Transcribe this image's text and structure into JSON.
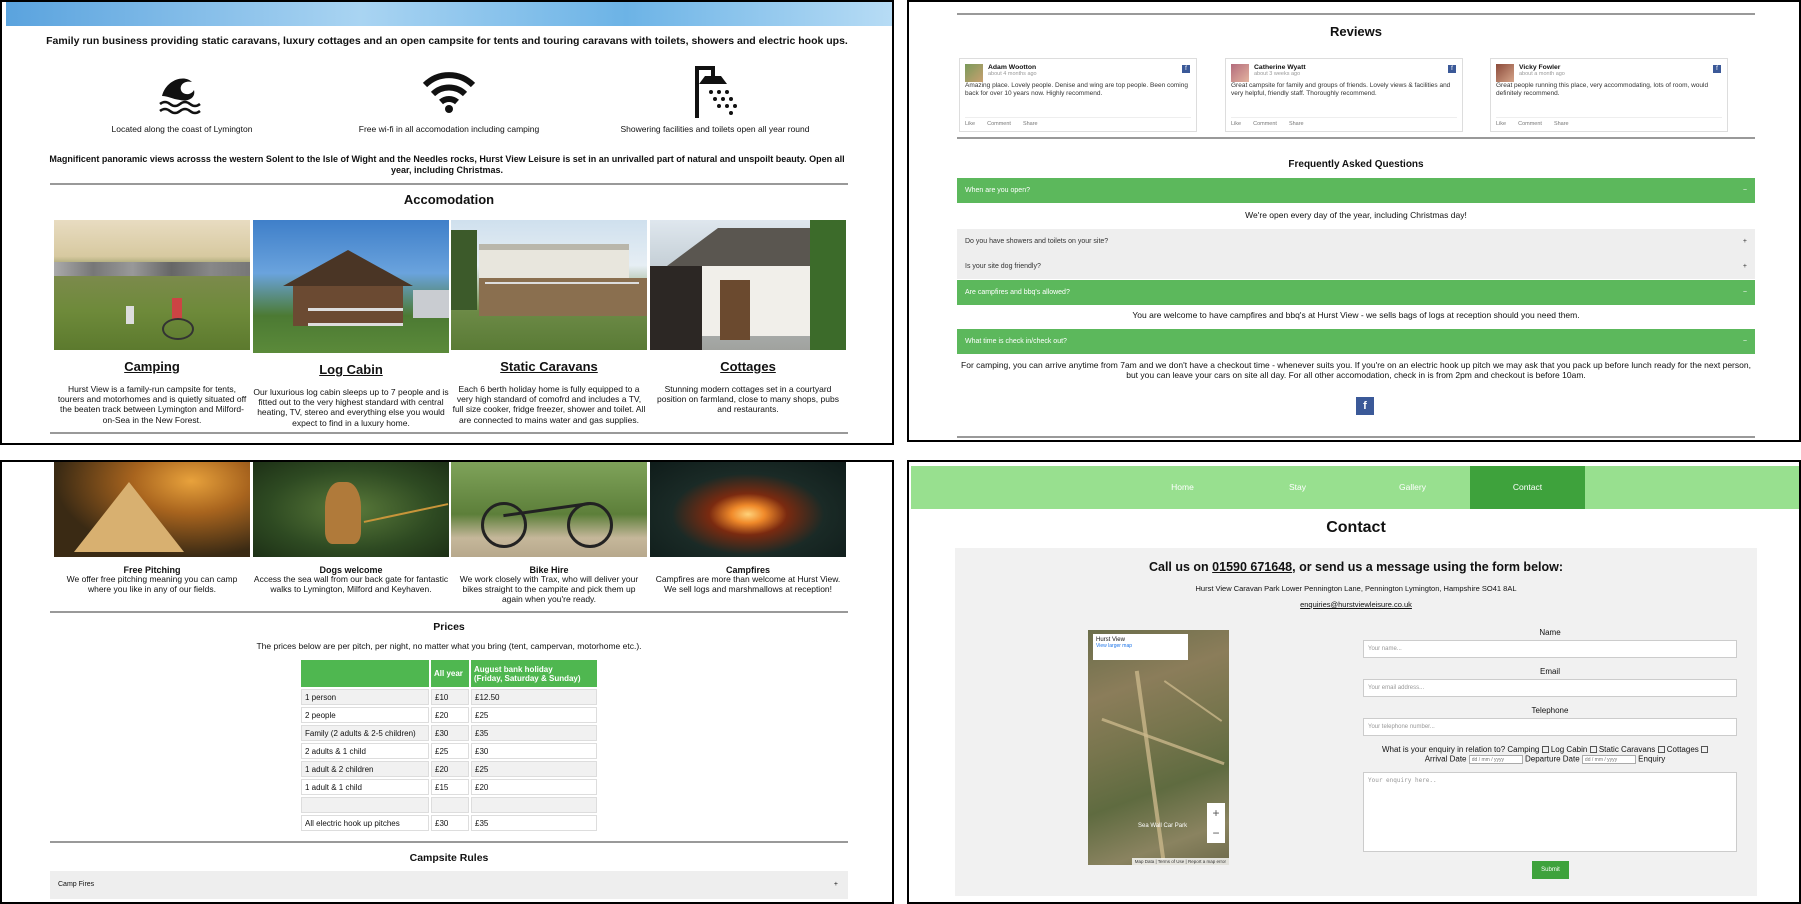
{
  "intro": {
    "tagline": "Family run business providing static caravans, luxury cottages and an open campsite for tents and touring caravans with toilets, showers and electric hook ups.",
    "features": [
      {
        "icon": "wave-icon",
        "caption": "Located along the coast of Lymington"
      },
      {
        "icon": "wifi-icon",
        "caption": "Free wi-fi in all accomodation including camping"
      },
      {
        "icon": "shower-icon",
        "caption": "Showering facilities and toilets open all year round"
      }
    ],
    "views": "Magnificent panoramic views acrosss the western Solent to the Isle of Wight and the Needles rocks, Hurst View Leisure is set in an unrivalled part of natural and unspoilt beauty. Open all year, including Christmas."
  },
  "accommodation": {
    "heading": "Accomodation",
    "cards": [
      {
        "title": "Camping",
        "desc": "Hurst View is a family-run campsite for tents, tourers and motorhomes and is quietly situated off the beaten track between Lymington and Milford-on-Sea in the New Forest."
      },
      {
        "title": "Log Cabin",
        "desc": "Our luxurious log cabin sleeps up to 7 people and is fitted out to the very highest standard with central heating, TV, stereo and everything else you would expect to find in a luxury home."
      },
      {
        "title": "Static Caravans",
        "desc": "Each 6 berth holiday home is fully equipped to a very high standard of comofrd and includes a TV, full size cooker, fridge freezer, shower and toilet. All are connected to mains water and gas supplies."
      },
      {
        "title": "Cottages",
        "desc": "Stunning modern cottages set in a courtyard position on farmland, close to many shops, pubs and restaurants."
      }
    ]
  },
  "reviews": {
    "heading": "Reviews",
    "items": [
      {
        "name": "Adam Wootton",
        "time": "about 4 months ago",
        "text": "Amazing place. Lovely people. Denise and wing are top people. Been coming back for over 10 years now. Highly recommend."
      },
      {
        "name": "Catherine Wyatt",
        "time": "about 3 weeks ago",
        "text": "Great campsite for family and groups of friends. Lovely views & facilities and very helpful, friendly staff. Thoroughly recommend."
      },
      {
        "name": "Vicky Fowler",
        "time": "about a month ago",
        "text": "Great people running this place, very accommodating, lots of room, would definitely recommend."
      }
    ],
    "actions": {
      "like": "Like",
      "comment": "Comment",
      "share": "Share"
    }
  },
  "faq": {
    "heading": "Frequently Asked Questions",
    "items": [
      {
        "q": "When are you open?",
        "a": "We're open every day of the year, including Christmas day!"
      },
      {
        "q": "Do you have showers and toilets on your site?"
      },
      {
        "q": "Is your site dog friendly?"
      },
      {
        "q": "Are campfires and bbq's allowed?",
        "a": "You are welcome to have campfires and bbq's at Hurst View - we sells bags of logs at reception should you need them."
      },
      {
        "q": "What time is check in/check out?",
        "a": "For camping, you can arrive anytime from 7am and we don't have a checkout time - whenever suits you. If you're on an electric hook up pitch we may ask that you pack up before lunch ready for the next person, but you can leave your cars on site all day. For all other accomodation, check in is from 2pm and checkout is before 10am."
      }
    ],
    "fb_label": "f"
  },
  "camping": {
    "cards": [
      {
        "title": "Free Pitching",
        "desc": "We offer free pitching meaning you can camp where you like in any of our fields."
      },
      {
        "title": "Dogs welcome",
        "desc": "Access the sea wall from our back gate for fantastic walks to Lymington, Milford and Keyhaven."
      },
      {
        "title": "Bike Hire",
        "desc": "We work closely with Trax, who will deliver your bikes straight to the campite and pick them up again when you're ready."
      },
      {
        "title": "Campfires",
        "desc": "Campfires are more than welcome at Hurst View. We sell logs and marshmallows at reception!"
      }
    ]
  },
  "prices": {
    "heading": "Prices",
    "note": "The prices below are per pitch, per night, no matter what you bring (tent, campervan, motorhome etc.).",
    "col_all": "All year",
    "col_aug1": "August bank holiday",
    "col_aug2": "(Friday, Saturday & Sunday)",
    "rows": [
      [
        "1 person",
        "£10",
        "£12.50"
      ],
      [
        "2 people",
        "£20",
        "£25"
      ],
      [
        "Family (2 adults & 2-5 children)",
        "£30",
        "£35"
      ],
      [
        "2 adults & 1 child",
        "£25",
        "£30"
      ],
      [
        "1 adult & 2 children",
        "£20",
        "£25"
      ],
      [
        "1 adult & 1 child",
        "£15",
        "£20"
      ],
      [
        "",
        "",
        ""
      ],
      [
        "All electric hook up pitches",
        "£30",
        "£35"
      ]
    ]
  },
  "rules": {
    "heading": "Campsite Rules",
    "first": "Camp Fires"
  },
  "nav": [
    "Home",
    "Stay",
    "Gallery",
    "Contact"
  ],
  "contact": {
    "heading": "Contact",
    "call_pre": "Call us on ",
    "phone": "01590 671648",
    "call_post": ", or send us a message using the form below:",
    "address": "Hurst View Caravan Park Lower Pennington Lane, Pennington Lymington, Hampshire SO41 8AL",
    "email": "enquiries@hurstviewleisure.co.uk",
    "map": {
      "place": "Hurst View",
      "link": "View larger map",
      "label": "Sea Wall Car Park",
      "footer": "Map Data | Terms of Use | Report a map error"
    },
    "form": {
      "name_label": "Name",
      "name_ph": "Your name...",
      "email_label": "Email",
      "email_ph": "Your email address...",
      "tel_label": "Telephone",
      "tel_ph": "Your telephone number...",
      "enquiry_q": "What is your enquiry in relation to? Camping",
      "opt_log": "Log Cabin",
      "opt_static": "Static Caravans",
      "opt_cottages": "Cottages",
      "arrival": "Arrival Date",
      "departure": "Departure Date",
      "enquiry": "Enquiry",
      "date_ph": "dd / mm / yyyy",
      "msg_ph": "Your enquiry here..",
      "submit": "Submit"
    }
  }
}
